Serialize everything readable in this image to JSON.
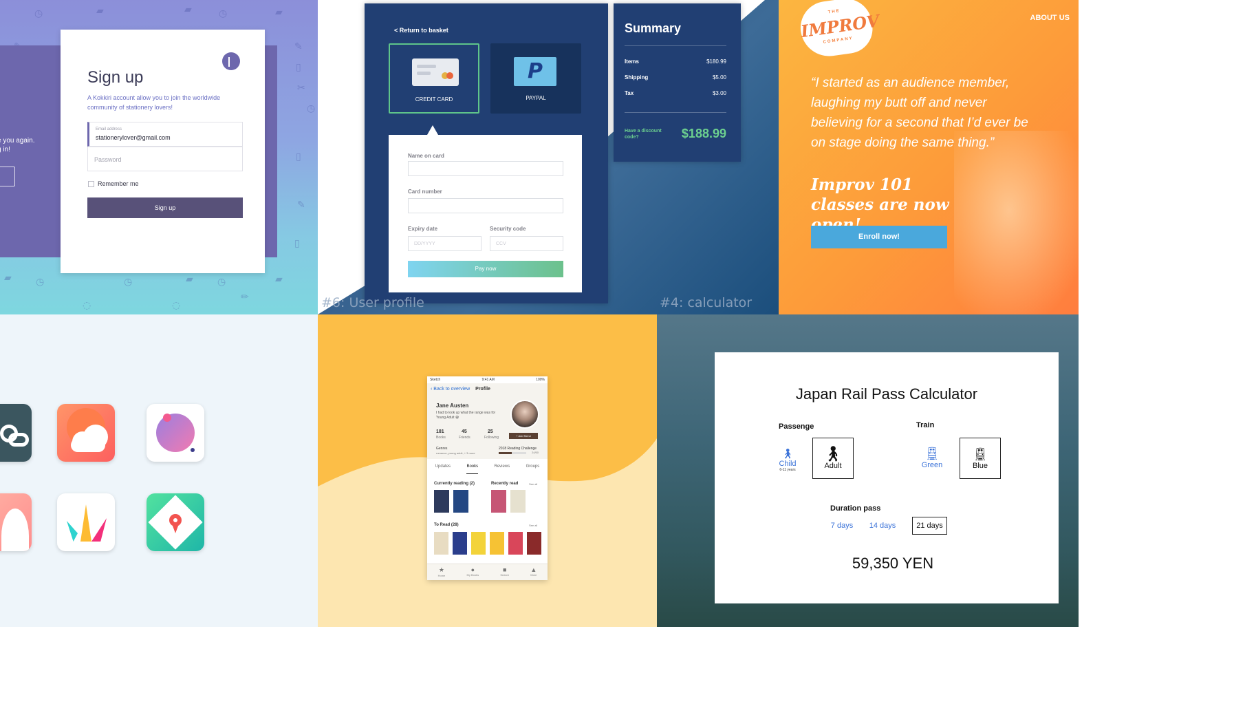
{
  "signup": {
    "title": "Sign up",
    "description": "A Kokkiri account allow you to join the worldwide community of stationery lovers!",
    "left_text_1": "e you again.",
    "left_text_2": "g in!",
    "email_label": "Email address",
    "email_value": "stationerylover@gmail.com",
    "password_placeholder": "Password",
    "remember_label": "Remember me",
    "button_label": "Sign up"
  },
  "checkout": {
    "return_link": "< Return to basket",
    "credit_card_label": "CREDIT CARD",
    "paypal_label": "PAYPAL",
    "paypal_glyph": "P",
    "name_label": "Name on card",
    "card_number_label": "Card number",
    "expiry_label": "Expiry date",
    "expiry_placeholder": "DD/YYYY",
    "security_label": "Security code",
    "security_placeholder": "CCV",
    "pay_button": "Pay now",
    "caption_left": "#6: User profile",
    "caption_right": "#4:  calculator",
    "summary": {
      "title": "Summary",
      "rows": [
        {
          "label": "Items",
          "value": "$180.99"
        },
        {
          "label": "Shipping",
          "value": "$5.00"
        },
        {
          "label": "Tax",
          "value": "$3.00"
        }
      ],
      "discount_text": "Have a discount code?",
      "total": "$188.99"
    }
  },
  "improv": {
    "badge_top": "THE",
    "badge_main": "IMPROV",
    "badge_bottom": "COMPANY",
    "about_link": "ABOUT US",
    "quote": "“I started as an audience member, laughing my butt off and never believing for a second that I’d ever be on stage doing the same thing.”",
    "promo": "Improv 101 classes are now open!",
    "enroll_button": "Enroll now!"
  },
  "phone": {
    "status_left": "Sketch",
    "status_time": "9:41 AM",
    "status_battery": "100%",
    "back_label": "Back to overview",
    "nav_title": "Profile",
    "name": "Jane Austen",
    "bio": "I had to look up what the range was for Young Adult 😅",
    "stats": [
      {
        "value": "181",
        "label": "Books"
      },
      {
        "value": "45",
        "label": "Friends"
      },
      {
        "value": "25",
        "label": "Following"
      }
    ],
    "add_friend": "+ Add friend",
    "genres_label": "Genres",
    "genres_value": "romance, young adult, + 3 more",
    "challenge_label": "2018 Reading Challenge",
    "challenge_value": "24/50",
    "tabs": [
      "Updates",
      "Books",
      "Reviews",
      "Groups"
    ],
    "currently_reading": "Currently reading (2)",
    "recently_read": "Recently read",
    "see_all": "See all",
    "to_read": "To Read (28)",
    "bottom_tabs": [
      "Home",
      "My Books",
      "Search",
      "More"
    ]
  },
  "rail": {
    "title": "Japan Rail Pass Calculator",
    "passenger_label": "Passenge",
    "train_label": "Train",
    "child_label": "Child",
    "child_sub": "6-11 years",
    "adult_label": "Adult",
    "green_label": "Green",
    "blue_label": "Blue",
    "duration_label": "Duration pass",
    "durations": [
      "7 days",
      "14 days",
      "21 days"
    ],
    "price": "59,350 YEN"
  }
}
